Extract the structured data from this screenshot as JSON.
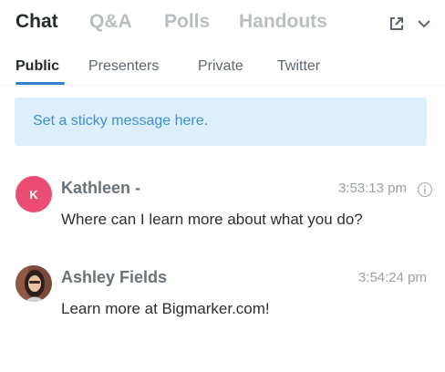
{
  "top_tabs": [
    {
      "label": "Chat",
      "active": true
    },
    {
      "label": "Q&A",
      "active": false
    },
    {
      "label": "Polls",
      "active": false
    },
    {
      "label": "Handouts",
      "active": false
    }
  ],
  "header_icons": {
    "popout": "popout-icon",
    "collapse": "chevron-down-icon"
  },
  "sub_tabs": [
    {
      "label": "Public",
      "active": true
    },
    {
      "label": "Presenters",
      "active": false
    },
    {
      "label": "Private",
      "active": false
    },
    {
      "label": "Twitter",
      "active": false
    }
  ],
  "sticky": {
    "placeholder": "Set a sticky message here."
  },
  "messages": [
    {
      "avatar_initial": "K",
      "sender": "Kathleen -",
      "time": "3:53:13 pm",
      "text": "Where can I learn more about what you do?",
      "has_info": true
    },
    {
      "avatar_initial": "",
      "sender": "Ashley Fields",
      "time": "3:54:24 pm",
      "text": "Learn more at Bigmarker.com!",
      "has_info": false
    }
  ],
  "colors": {
    "accent": "#2f80d1",
    "sticky_bg": "#deeffc",
    "sticky_text": "#3a8fd9",
    "avatar_k": "#ea4c74",
    "inactive_tab": "#b9bec4"
  }
}
